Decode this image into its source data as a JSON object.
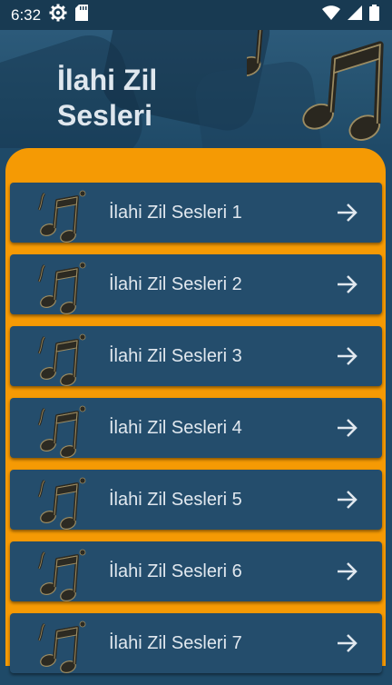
{
  "status_bar": {
    "time": "6:32"
  },
  "header": {
    "title": "İlahi Zil\nSesleri"
  },
  "list": {
    "items": [
      {
        "label": "İlahi Zil Sesleri 1"
      },
      {
        "label": "İlahi Zil Sesleri 2"
      },
      {
        "label": "İlahi Zil Sesleri 3"
      },
      {
        "label": "İlahi Zil Sesleri 4"
      },
      {
        "label": "İlahi Zil Sesleri 5"
      },
      {
        "label": "İlahi Zil Sesleri 6"
      },
      {
        "label": "İlahi Zil Sesleri 7"
      }
    ]
  },
  "colors": {
    "accent": "#f59a04",
    "row": "#244d6c",
    "background": "#1f4a68"
  },
  "icons": {
    "row_icon": "music-note-icon",
    "row_action": "arrow-right-icon"
  }
}
